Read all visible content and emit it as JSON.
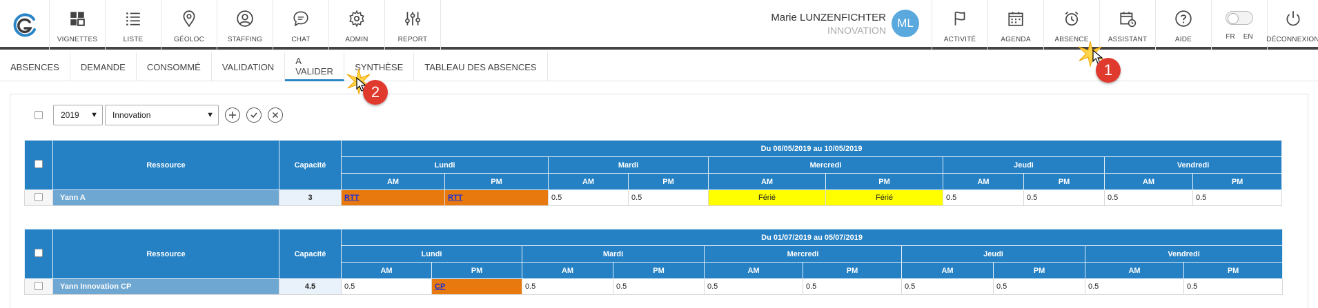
{
  "topnav": {
    "left_items": [
      {
        "label": "VIGNETTES",
        "icon": "grid-icon"
      },
      {
        "label": "LISTE",
        "icon": "list-icon"
      },
      {
        "label": "GÉOLOC",
        "icon": "map-pin-icon"
      },
      {
        "label": "STAFFING",
        "icon": "user-circle-icon"
      },
      {
        "label": "CHAT",
        "icon": "chat-bubble-icon"
      },
      {
        "label": "ADMIN",
        "icon": "gear-icon"
      },
      {
        "label": "REPORT",
        "icon": "sliders-icon"
      }
    ],
    "user": {
      "name": "Marie LUNZENFICHTER",
      "org": "INNOVATION",
      "initials": "ML"
    },
    "right_items": [
      {
        "label": "ACTIVITÉ",
        "icon": "flag-icon"
      },
      {
        "label": "AGENDA",
        "icon": "calendar-icon"
      },
      {
        "label": "ABSENCE",
        "icon": "alarm-clock-icon"
      },
      {
        "label": "ASSISTANT",
        "icon": "calendar-clock-icon"
      },
      {
        "label": "AIDE",
        "icon": "question-circle-icon"
      }
    ],
    "lang": {
      "fr": "FR",
      "en": "EN"
    },
    "logout": "DÉCONNEXION"
  },
  "tabs": [
    "ABSENCES",
    "DEMANDE",
    "CONSOMMÉ",
    "VALIDATION",
    "A VALIDER",
    "SYNTHÈSE",
    "TABLEAU DES ABSENCES"
  ],
  "active_tab": "A VALIDER",
  "filters": {
    "year": "2019",
    "team": "Innovation"
  },
  "table_headers": {
    "resource": "Ressource",
    "capacity": "Capacité",
    "am": "AM",
    "pm": "PM",
    "days": [
      "Lundi",
      "Mardi",
      "Mercredi",
      "Jeudi",
      "Vendredi"
    ]
  },
  "tables": [
    {
      "period": "Du 06/05/2019 au 10/05/2019",
      "resource": "Yann A",
      "capacity": "3",
      "cells": [
        {
          "text": "RTT",
          "kind": "absence"
        },
        {
          "text": "RTT",
          "kind": "absence"
        },
        {
          "text": "0.5",
          "kind": "value"
        },
        {
          "text": "0.5",
          "kind": "value"
        },
        {
          "text": "Férié",
          "kind": "holiday"
        },
        {
          "text": "Férié",
          "kind": "holiday"
        },
        {
          "text": "0.5",
          "kind": "value"
        },
        {
          "text": "0.5",
          "kind": "value"
        },
        {
          "text": "0.5",
          "kind": "value"
        },
        {
          "text": "0.5",
          "kind": "value"
        }
      ]
    },
    {
      "period": "Du 01/07/2019 au 05/07/2019",
      "resource": "Yann Innovation CP",
      "capacity": "4.5",
      "cells": [
        {
          "text": "0.5",
          "kind": "value"
        },
        {
          "text": "CP",
          "kind": "absence"
        },
        {
          "text": "0.5",
          "kind": "value"
        },
        {
          "text": "0.5",
          "kind": "value"
        },
        {
          "text": "0.5",
          "kind": "value"
        },
        {
          "text": "0.5",
          "kind": "value"
        },
        {
          "text": "0.5",
          "kind": "value"
        },
        {
          "text": "0.5",
          "kind": "value"
        },
        {
          "text": "0.5",
          "kind": "value"
        },
        {
          "text": "0.5",
          "kind": "value"
        }
      ]
    }
  ],
  "annotations": {
    "step1": "1",
    "step2": "2"
  },
  "colors": {
    "header_blue": "#2581c4",
    "name_blue": "#6ea7d2",
    "absence_orange": "#e8790f",
    "holiday_yellow": "#ffff00",
    "badge_red": "#e03a2f"
  }
}
